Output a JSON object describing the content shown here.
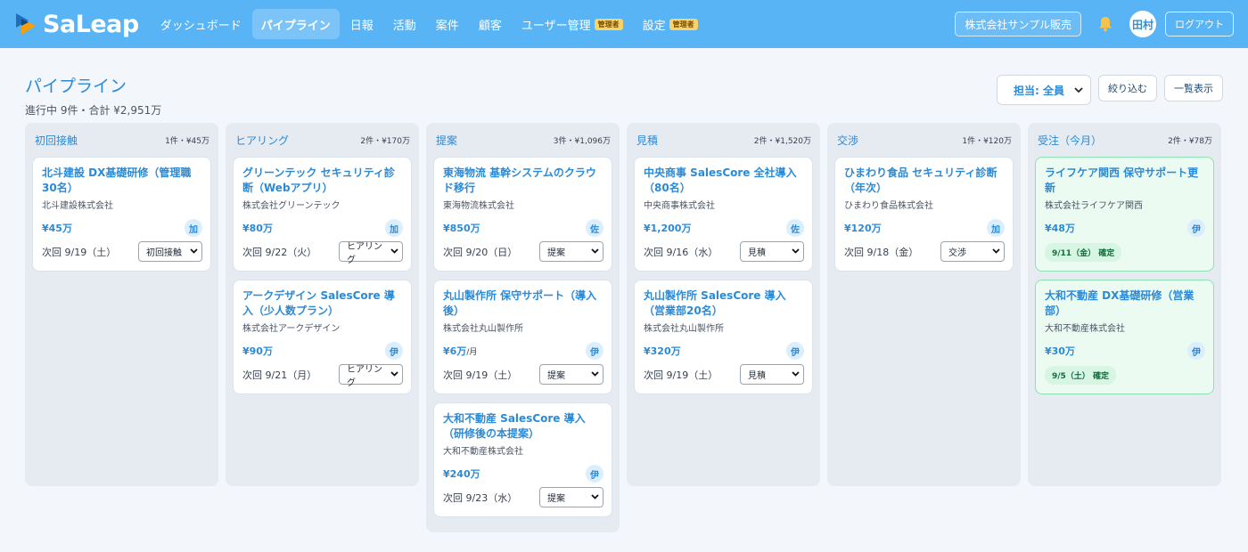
{
  "header": {
    "logo_text": "SaLeap",
    "nav": [
      {
        "label": "ダッシュボード",
        "active": false,
        "admin": ""
      },
      {
        "label": "パイプライン",
        "active": true,
        "admin": ""
      },
      {
        "label": "日報",
        "active": false,
        "admin": ""
      },
      {
        "label": "活動",
        "active": false,
        "admin": ""
      },
      {
        "label": "案件",
        "active": false,
        "admin": ""
      },
      {
        "label": "顧客",
        "active": false,
        "admin": ""
      },
      {
        "label": "ユーザー管理",
        "active": false,
        "admin": "管理者"
      },
      {
        "label": "設定",
        "active": false,
        "admin": "管理者"
      }
    ],
    "company": "株式会社サンプル販売",
    "user_initials": "田村",
    "logout": "ログアウト",
    "brand_color": "#58b4f5"
  },
  "page": {
    "title": "パイプライン",
    "subtitle": "進行中 9件・合計 ¥2,951万",
    "assignee_filter": "担当: 全員",
    "filter_button": "絞り込む",
    "list_button": "一覧表示"
  },
  "columns": [
    {
      "title": "初回接触",
      "meta": "1件・¥45万",
      "cards": [
        {
          "title": "北斗建設 DX基礎研修（管理職30名）",
          "company": "北斗建設株式会社",
          "amount": "¥45万",
          "unit": "",
          "owner": "加",
          "next": "次回 9/19（土）",
          "stage": "初回接触"
        }
      ]
    },
    {
      "title": "ヒアリング",
      "meta": "2件・¥170万",
      "cards": [
        {
          "title": "グリーンテック セキュリティ診断（Webアプリ）",
          "company": "株式会社グリーンテック",
          "amount": "¥80万",
          "unit": "",
          "owner": "加",
          "next": "次回 9/22（火）",
          "stage": "ヒアリング"
        },
        {
          "title": "アークデザイン SalesCore 導入（少人数プラン）",
          "company": "株式会社アークデザイン",
          "amount": "¥90万",
          "unit": "",
          "owner": "伊",
          "next": "次回 9/21（月）",
          "stage": "ヒアリング"
        }
      ]
    },
    {
      "title": "提案",
      "meta": "3件・¥1,096万",
      "cards": [
        {
          "title": "東海物流 基幹システムのクラウド移行",
          "company": "東海物流株式会社",
          "amount": "¥850万",
          "unit": "",
          "owner": "佐",
          "next": "次回 9/20（日）",
          "stage": "提案"
        },
        {
          "title": "丸山製作所 保守サポート（導入後）",
          "company": "株式会社丸山製作所",
          "amount": "¥6万",
          "unit": "/月",
          "owner": "伊",
          "next": "次回 9/19（土）",
          "stage": "提案"
        },
        {
          "title": "大和不動産 SalesCore 導入（研修後の本提案）",
          "company": "大和不動産株式会社",
          "amount": "¥240万",
          "unit": "",
          "owner": "伊",
          "next": "次回 9/23（水）",
          "stage": "提案"
        }
      ]
    },
    {
      "title": "見積",
      "meta": "2件・¥1,520万",
      "cards": [
        {
          "title": "中央商事 SalesCore 全社導入（80名）",
          "company": "中央商事株式会社",
          "amount": "¥1,200万",
          "unit": "",
          "owner": "佐",
          "next": "次回 9/16（水）",
          "stage": "見積"
        },
        {
          "title": "丸山製作所 SalesCore 導入（営業部20名）",
          "company": "株式会社丸山製作所",
          "amount": "¥320万",
          "unit": "",
          "owner": "伊",
          "next": "次回 9/19（土）",
          "stage": "見積"
        }
      ]
    },
    {
      "title": "交渉",
      "meta": "1件・¥120万",
      "cards": [
        {
          "title": "ひまわり食品 セキュリティ診断（年次）",
          "company": "ひまわり食品株式会社",
          "amount": "¥120万",
          "unit": "",
          "owner": "加",
          "next": "次回 9/18（金）",
          "stage": "交渉"
        }
      ]
    },
    {
      "title": "受注（今月）",
      "meta": "2件・¥78万",
      "cards": [
        {
          "title": "ライフケア関西 保守サポート更新",
          "company": "株式会社ライフケア関西",
          "amount": "¥48万",
          "unit": "",
          "owner": "伊",
          "confirmed": "9/11（金） 確定"
        },
        {
          "title": "大和不動産 DX基礎研修（営業部）",
          "company": "大和不動産株式会社",
          "amount": "¥30万",
          "unit": "",
          "owner": "伊",
          "confirmed": "9/5（土） 確定"
        }
      ]
    }
  ]
}
